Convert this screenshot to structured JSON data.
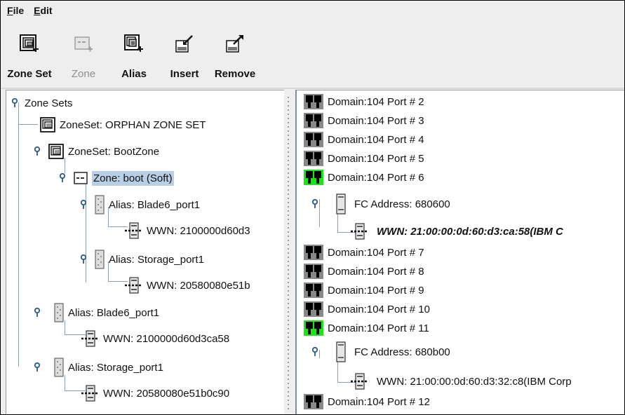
{
  "menu": {
    "file_prefix": "F",
    "file_rest": "ile",
    "edit_prefix": "E",
    "edit_rest": "dit"
  },
  "toolbar": {
    "zone_set": "Zone Set",
    "zone": "Zone",
    "alias": "Alias",
    "insert": "Insert",
    "remove": "Remove"
  },
  "left_tree": {
    "root": "Zone Sets",
    "orphan": "ZoneSet: ORPHAN ZONE SET",
    "bootzone": "ZoneSet: BootZone",
    "zone_boot": "Zone: boot (Soft)",
    "alias_blade_nested": "Alias: Blade6_port1",
    "wwn_blade_nested": "WWN: 2100000d60d3",
    "alias_storage_nested": "Alias: Storage_port1",
    "wwn_storage_nested": "WWN: 20580080e51b",
    "alias_blade": "Alias: Blade6_port1",
    "wwn_blade": "WWN: 2100000d60d3ca58",
    "alias_storage": "Alias: Storage_port1",
    "wwn_storage": "WWN: 20580080e51b0c90"
  },
  "right_tree": {
    "p2": "Domain:104 Port # 2",
    "p3": "Domain:104 Port # 3",
    "p4": "Domain:104 Port # 4",
    "p5": "Domain:104 Port # 5",
    "p6": "Domain:104 Port # 6",
    "fc6": "FC Address: 680600",
    "wwn6": "WWN: 21:00:00:0d:60:d3:ca:58(IBM C",
    "p7": "Domain:104 Port # 7",
    "p8": "Domain:104 Port # 8",
    "p9": "Domain:104 Port # 9",
    "p10": "Domain:104 Port # 10",
    "p11": "Domain:104 Port # 11",
    "fc11": "FC Address: 680b00",
    "wwn11": "WWN: 21:00:00:0d:60:d3:32:c8(IBM Corp",
    "p12": "Domain:104 Port # 12"
  },
  "colors": {
    "port_active": "#19e619",
    "port_inactive": "#888888",
    "selection": "#b8cfe5"
  }
}
